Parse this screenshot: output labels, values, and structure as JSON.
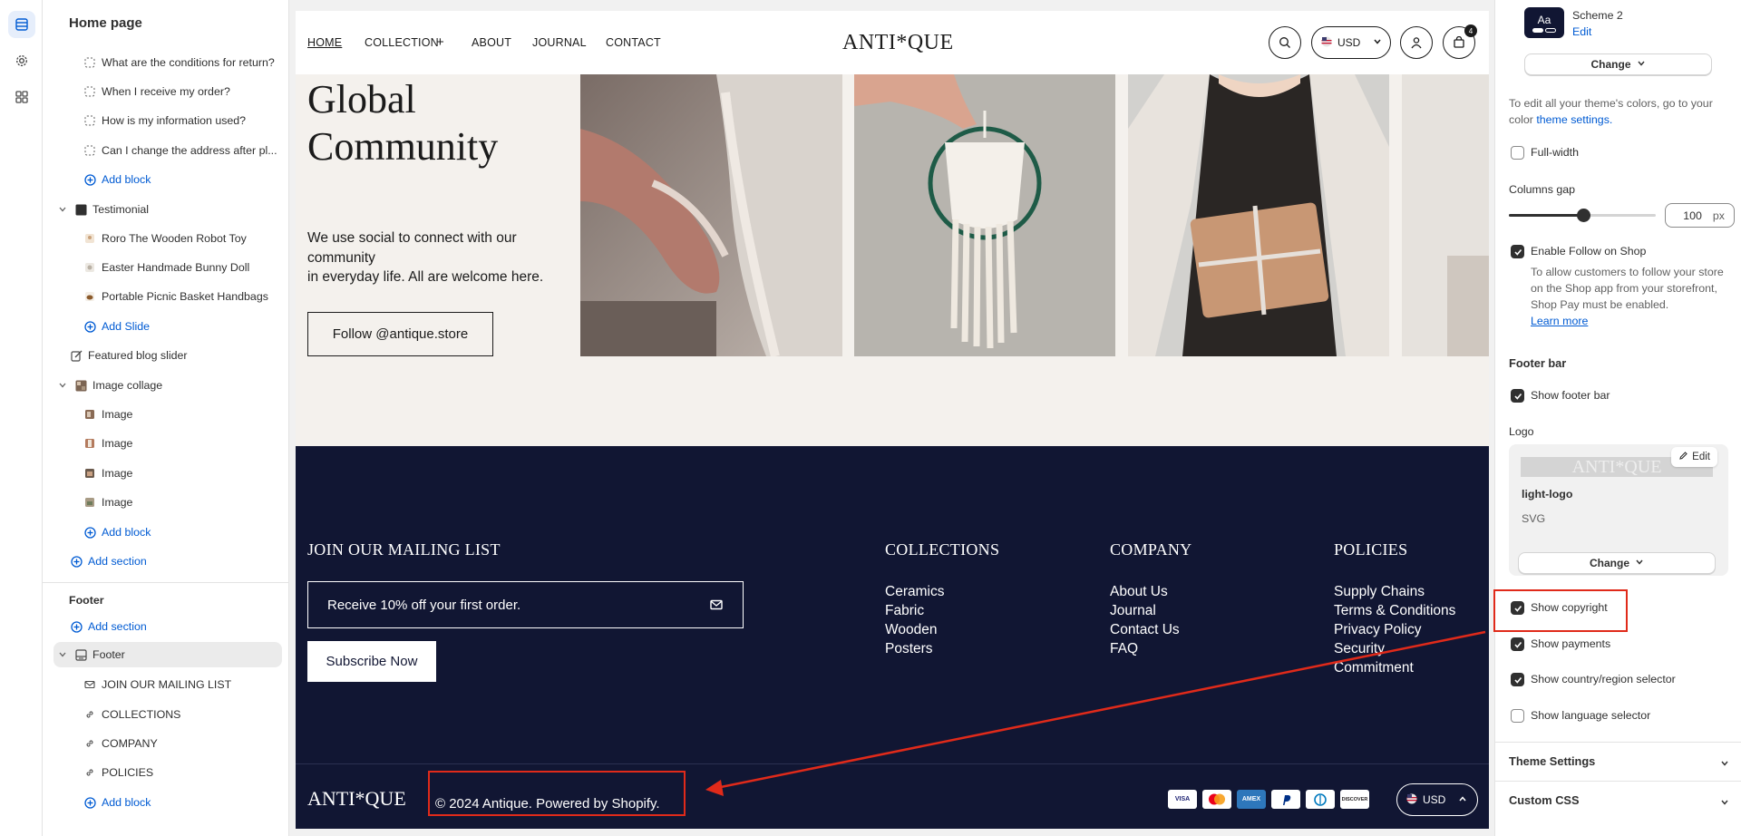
{
  "left_panel": {
    "header": "Home page",
    "tree": [
      {
        "label": "What are the conditions for return?",
        "icon": "block-icon"
      },
      {
        "label": "When I receive my order?",
        "icon": "block-icon"
      },
      {
        "label": "How is my information used?",
        "icon": "block-icon"
      },
      {
        "label": "Can I change the address after pl...",
        "icon": "block-icon"
      },
      {
        "label": "Add block",
        "kind": "add"
      },
      {
        "label": "Testimonial",
        "kind": "section"
      },
      {
        "label": "Roro The Wooden Robot Toy",
        "icon": "thumb-icon"
      },
      {
        "label": "Easter Handmade Bunny Doll",
        "icon": "thumb-icon"
      },
      {
        "label": "Portable Picnic Basket Handbags",
        "icon": "thumb-icon"
      },
      {
        "label": "Add Slide",
        "kind": "add"
      },
      {
        "label": "Featured blog slider",
        "kind": "section"
      },
      {
        "label": "Image collage",
        "kind": "section"
      },
      {
        "label": "Image",
        "icon": "image-icon"
      },
      {
        "label": "Image",
        "icon": "image-icon"
      },
      {
        "label": "Image",
        "icon": "image-icon"
      },
      {
        "label": "Image",
        "icon": "image-icon"
      },
      {
        "label": "Add block",
        "kind": "add"
      },
      {
        "label": "Add section",
        "kind": "add"
      }
    ],
    "footer_group": {
      "title": "Footer",
      "add_section": "Add section",
      "footer_item": "Footer",
      "children": [
        "JOIN OUR MAILING LIST",
        "COLLECTIONS",
        "COMPANY",
        "POLICIES"
      ],
      "add_block": "Add block"
    }
  },
  "preview": {
    "nav": {
      "links": [
        "HOME",
        "COLLECTION",
        "ABOUT",
        "JOURNAL",
        "CONTACT"
      ],
      "logo": "ANTI*QUE",
      "currency": "USD",
      "cart_count": "4"
    },
    "hero": {
      "title_line1": "Global",
      "title_line2": "Community",
      "text_line1": "We use social to connect with our community",
      "text_line2": "in everyday life. All are welcome here.",
      "follow_button": "Follow @antique.store"
    },
    "footer": {
      "mailing_title": "JOIN OUR MAILING LIST",
      "email_placeholder": "Receive 10% off your first order.",
      "subscribe": "Subscribe Now",
      "columns": [
        {
          "title": "COLLECTIONS",
          "items": [
            "Ceramics",
            "Fabric",
            "Wooden",
            "Posters"
          ]
        },
        {
          "title": "COMPANY",
          "items": [
            "About Us",
            "Journal",
            "Contact Us",
            "FAQ"
          ]
        },
        {
          "title": "POLICIES",
          "items": [
            "Supply Chains",
            "Terms & Conditions",
            "Privacy Policy",
            "Security",
            "Commitment"
          ]
        }
      ],
      "logo": "ANTI*QUE",
      "copyright": "© 2024 Antique. Powered by Shopify.",
      "payments": [
        "VISA",
        "MC",
        "AMEX",
        "PayPal",
        "Diners",
        "DISCOVER"
      ],
      "currency": "USD"
    }
  },
  "right_panel": {
    "scheme_name": "Scheme 2",
    "scheme_edit": "Edit",
    "scheme_swatch": "Aa",
    "change_label": "Change",
    "colors_note": "To edit all your theme's colors, go to your color",
    "colors_link": "theme settings.",
    "full_width": {
      "label": "Full-width",
      "checked": false
    },
    "columns_gap": {
      "label": "Columns gap",
      "value": "100",
      "unit": "px",
      "percent": 100
    },
    "follow_on_shop": {
      "label": "Enable Follow on Shop",
      "checked": true,
      "help": "To allow customers to follow your store on the Shop app from your storefront, Shop Pay must be enabled.",
      "link": "Learn more"
    },
    "footer_bar_title": "Footer bar",
    "show_footer_bar": {
      "label": "Show footer bar",
      "checked": true
    },
    "logo_title": "Logo",
    "logo_name": "light-logo",
    "logo_type": "SVG",
    "logo_edit": "Edit",
    "logo_preview_text": "ANTI*QUE",
    "show_copyright": {
      "label": "Show copyright",
      "checked": true
    },
    "show_payments": {
      "label": "Show payments",
      "checked": true
    },
    "show_country": {
      "label": "Show country/region selector",
      "checked": true
    },
    "show_language": {
      "label": "Show language selector",
      "checked": false
    },
    "theme_settings": "Theme Settings",
    "custom_css": "Custom CSS"
  },
  "annotation_color": "#e02a1a"
}
